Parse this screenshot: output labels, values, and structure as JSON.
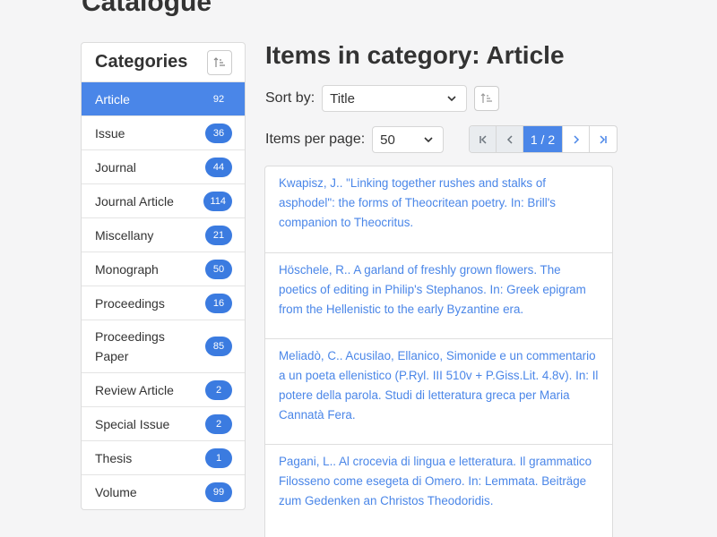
{
  "page": {
    "title": "Catalogue"
  },
  "sidebar": {
    "title": "Categories",
    "sort_icon": "sort-ascending-icon",
    "items": [
      {
        "label": "Article",
        "count": "92",
        "active": true
      },
      {
        "label": "Issue",
        "count": "36"
      },
      {
        "label": "Journal",
        "count": "44"
      },
      {
        "label": "Journal Article",
        "count": "114"
      },
      {
        "label": "Miscellany",
        "count": "21"
      },
      {
        "label": "Monograph",
        "count": "50"
      },
      {
        "label": "Proceedings",
        "count": "16"
      },
      {
        "label": "Proceedings Paper",
        "count": "85"
      },
      {
        "label": "Review Article",
        "count": "2"
      },
      {
        "label": "Special Issue",
        "count": "2"
      },
      {
        "label": "Thesis",
        "count": "1"
      },
      {
        "label": "Volume",
        "count": "99"
      }
    ]
  },
  "main": {
    "title": "Items in category: Article",
    "sort": {
      "label": "Sort by:",
      "value": "Title"
    },
    "per_page": {
      "label": "Items per page:",
      "value": "50"
    },
    "pager": {
      "first": "first-page-icon",
      "prev": "prev-page-icon",
      "current": "1 / 2",
      "next": "next-page-icon",
      "last": "last-page-icon"
    },
    "results": [
      "Kwapisz, J.. \"Linking together rushes and stalks of asphodel\": the forms of Theocritean poetry. In: Brill's companion to Theocritus.",
      "Höschele, R.. A garland of freshly grown flowers. The poetics of editing in Philip's Stephanos. In: Greek epigram from the Hellenistic to the early Byzantine era.",
      "Meliadò, C.. Acusilao, Ellanico, Simonide e un commentario a un poeta ellenistico (P.Ryl. III 510v + P.Giss.Lit. 4.8v). In: Il potere della parola. Studi di letteratura greca per Maria Cannatà Fera.",
      "Pagani, L.. Al crocevia di lingua e letteratura. Il grammatico Filosseno come esegeta di Omero. In: Lemmata. Beiträge zum Gedenken an Christos Theodoridis."
    ]
  },
  "colors": {
    "accent": "#4a86e8",
    "badge": "#3b7be0",
    "background": "#f5f5f6"
  }
}
